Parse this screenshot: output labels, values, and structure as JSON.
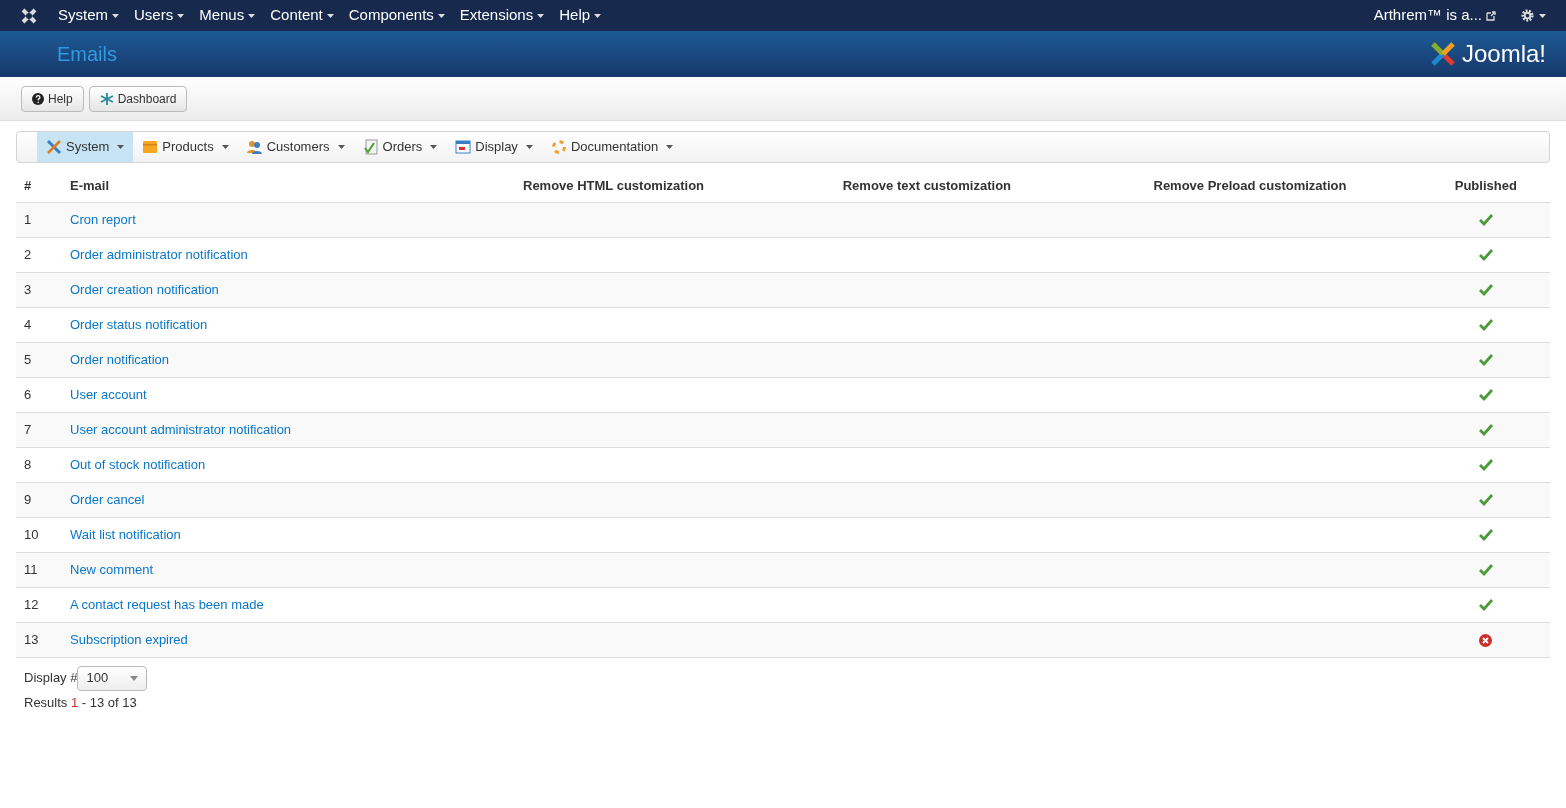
{
  "top_menu": [
    {
      "label": "System"
    },
    {
      "label": "Users"
    },
    {
      "label": "Menus"
    },
    {
      "label": "Content"
    },
    {
      "label": "Components"
    },
    {
      "label": "Extensions"
    },
    {
      "label": "Help"
    }
  ],
  "site_link": "Arthrem™ is a...",
  "page_title": "Emails",
  "logo_text": "Joomla!",
  "toolbar": [
    {
      "label": "Help",
      "kind": "help"
    },
    {
      "label": "Dashboard",
      "kind": "dashboard"
    }
  ],
  "sub_menu": [
    {
      "label": "System",
      "kind": "tools",
      "selected": true
    },
    {
      "label": "Products",
      "kind": "box",
      "selected": false
    },
    {
      "label": "Customers",
      "kind": "people",
      "selected": false
    },
    {
      "label": "Orders",
      "kind": "document",
      "selected": false
    },
    {
      "label": "Display",
      "kind": "window",
      "selected": false
    },
    {
      "label": "Documentation",
      "kind": "lifebuoy",
      "selected": false
    }
  ],
  "table": {
    "columns": [
      "#",
      "E-mail",
      "Remove HTML customization",
      "Remove text customization",
      "Remove Preload customization",
      "Published"
    ],
    "rows": [
      {
        "num": "1",
        "email": "Cron report",
        "published": true
      },
      {
        "num": "2",
        "email": "Order administrator notification",
        "published": true
      },
      {
        "num": "3",
        "email": "Order creation notification",
        "published": true
      },
      {
        "num": "4",
        "email": "Order status notification",
        "published": true
      },
      {
        "num": "5",
        "email": "Order notification",
        "published": true
      },
      {
        "num": "6",
        "email": "User account",
        "published": true
      },
      {
        "num": "7",
        "email": "User account administrator notification",
        "published": true
      },
      {
        "num": "8",
        "email": "Out of stock notification",
        "published": true
      },
      {
        "num": "9",
        "email": "Order cancel",
        "published": true
      },
      {
        "num": "10",
        "email": "Wait list notification",
        "published": true
      },
      {
        "num": "11",
        "email": "New comment",
        "published": true
      },
      {
        "num": "12",
        "email": "A contact request has been made",
        "published": true
      },
      {
        "num": "13",
        "email": "Subscription expired",
        "published": false
      }
    ]
  },
  "display_label": "Display #",
  "display_value": "100",
  "results": {
    "label": "Results",
    "start": "1",
    "rest": "- 13 of 13"
  }
}
